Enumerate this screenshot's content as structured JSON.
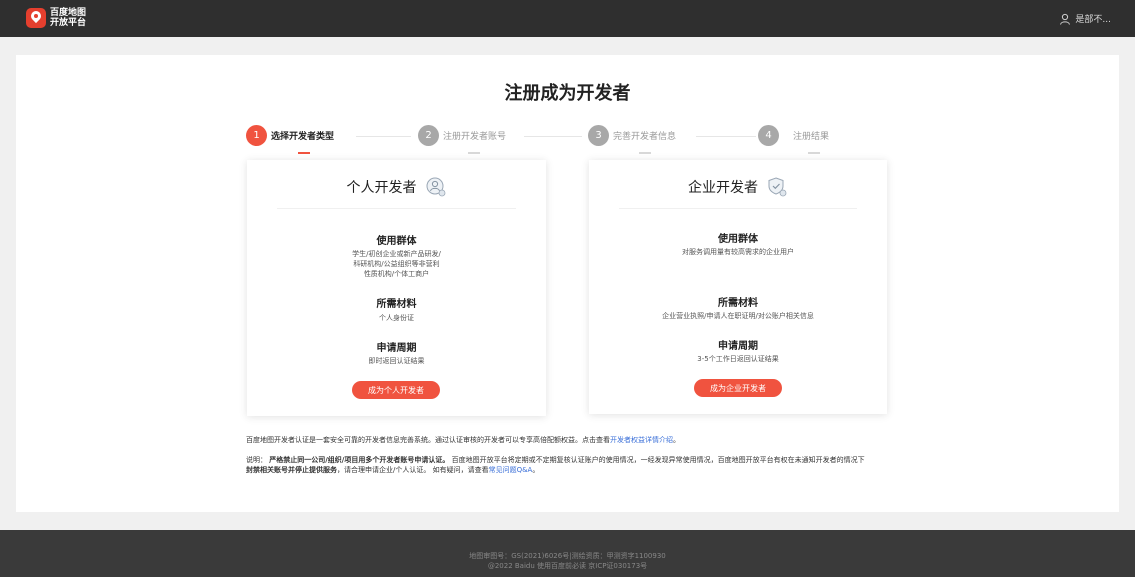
{
  "header": {
    "logo_line1": "百度地图",
    "logo_line2": "开放平台",
    "username": "是部不..."
  },
  "page_title": "注册成为开发者",
  "steps": [
    {
      "num": "1",
      "label": "选择开发者类型"
    },
    {
      "num": "2",
      "label": "注册开发者账号"
    },
    {
      "num": "3",
      "label": "完善开发者信息"
    },
    {
      "num": "4",
      "label": "注册结果"
    }
  ],
  "personal": {
    "title": "个人开发者",
    "group_head": "使用群体",
    "group_line1": "学生/初创企业或新产品研发/",
    "group_line2": "科研机构/公益组织等非营利",
    "group_line3": "性质机构/个体工商户",
    "materials_head": "所需材料",
    "materials": "个人身份证",
    "period_head": "申请周期",
    "period": "即时返回认证结果",
    "button": "成为个人开发者"
  },
  "enterprise": {
    "title": "企业开发者",
    "group_head": "使用群体",
    "group": "对服务调用量有较高需求的企业用户",
    "materials_head": "所需材料",
    "materials": "企业营业执照/申请人在职证明/对公账户相关信息",
    "period_head": "申请周期",
    "period": "3-5个工作日返回认证结果",
    "button": "成为企业开发者"
  },
  "notes": {
    "intro": "百度地图开发者认证是一套安全可靠的开发者信息完善系统。通过认证审核的开发者可以专享高倍配额权益。点击查看",
    "intro_link": "开发者权益详情介绍",
    "intro_end": "。",
    "desc_prefix": "说明：",
    "desc_bold1": "严格禁止同一公司/组织/项目用多个开发者账号申请认证。",
    "desc_mid": "百度地图开放平台将定期或不定期复核认证账户的使用情况，一经发现异常使用情况，百度地图开放平台有权在未通知开发者的情况下",
    "desc_bold2": "封禁相关账号并停止提供服务",
    "desc_end": "，请合理申请企业/个人认证。 如有疑问，请查看",
    "desc_link": "常见问题Q&A",
    "desc_tail": "。"
  },
  "footer": {
    "line1": "地图审图号：GS(2021)6026号|测绘资质：甲测资字1100930",
    "line2": "@2022 Baidu 使用百度前必读 京ICP证030173号"
  },
  "colors": {
    "accent": "#f0533f",
    "header_bg": "#2f2f2f",
    "footer_bg": "#3a3a3a",
    "link": "#3a6fd8"
  }
}
